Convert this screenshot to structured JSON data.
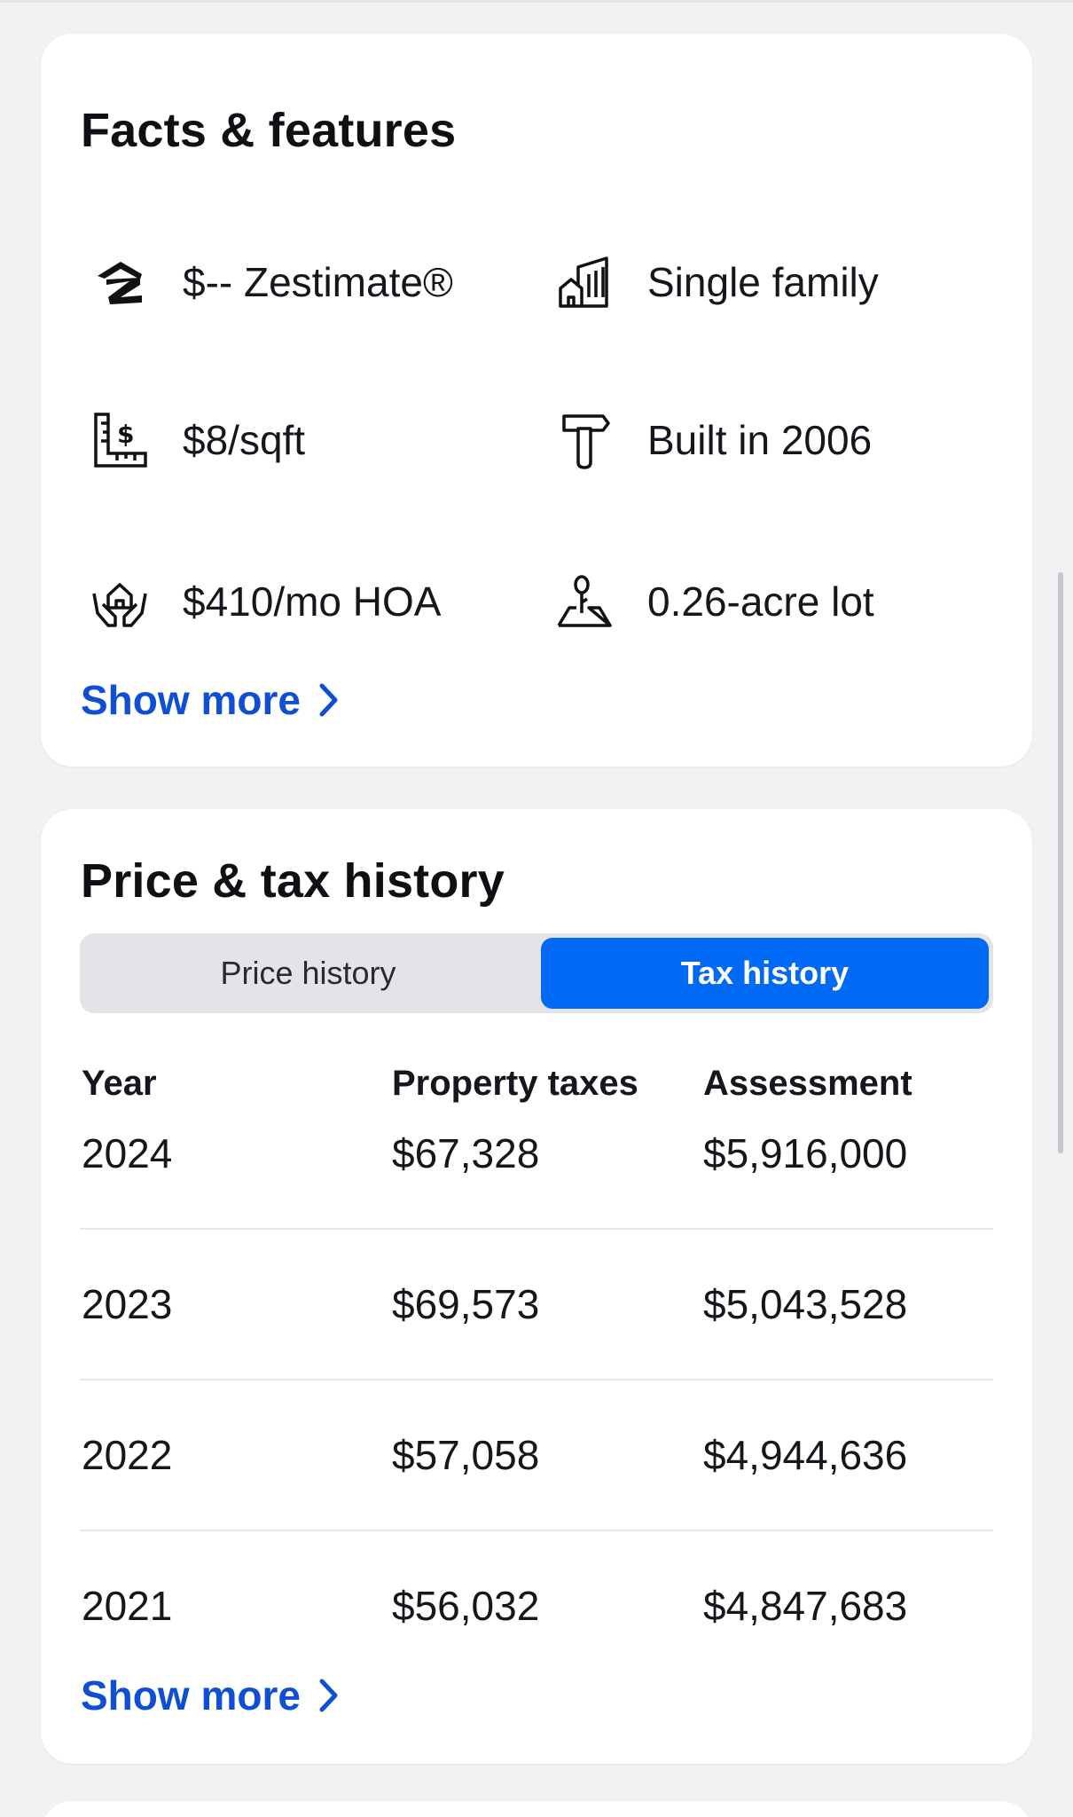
{
  "facts": {
    "title": "Facts & features",
    "items": [
      {
        "icon": "zillow-logo-icon",
        "label": "$-- Zestimate®"
      },
      {
        "icon": "building-icon",
        "label": "Single family"
      },
      {
        "icon": "price-per-sqft-icon",
        "label": "$8/sqft"
      },
      {
        "icon": "hammer-icon",
        "label": "Built in 2006"
      },
      {
        "icon": "hoa-hands-house-icon",
        "label": "$410/mo HOA"
      },
      {
        "icon": "lot-tree-icon",
        "label": "0.26-acre lot"
      }
    ],
    "show_more": "Show more"
  },
  "tax": {
    "title": "Price & tax history",
    "tabs": [
      {
        "label": "Price history",
        "active": false
      },
      {
        "label": "Tax history",
        "active": true
      }
    ],
    "columns": [
      "Year",
      "Property taxes",
      "Assessment"
    ],
    "rows": [
      {
        "year": "2024",
        "taxes": "$67,328",
        "assessment": "$5,916,000"
      },
      {
        "year": "2023",
        "taxes": "$69,573",
        "assessment": "$5,043,528"
      },
      {
        "year": "2022",
        "taxes": "$57,058",
        "assessment": "$4,944,636"
      },
      {
        "year": "2021",
        "taxes": "$56,032",
        "assessment": "$4,847,683"
      }
    ],
    "show_more": "Show more"
  },
  "colors": {
    "link": "#0f4fd6",
    "tab_active": "#006af5",
    "tab_track": "#e4e4e8"
  }
}
